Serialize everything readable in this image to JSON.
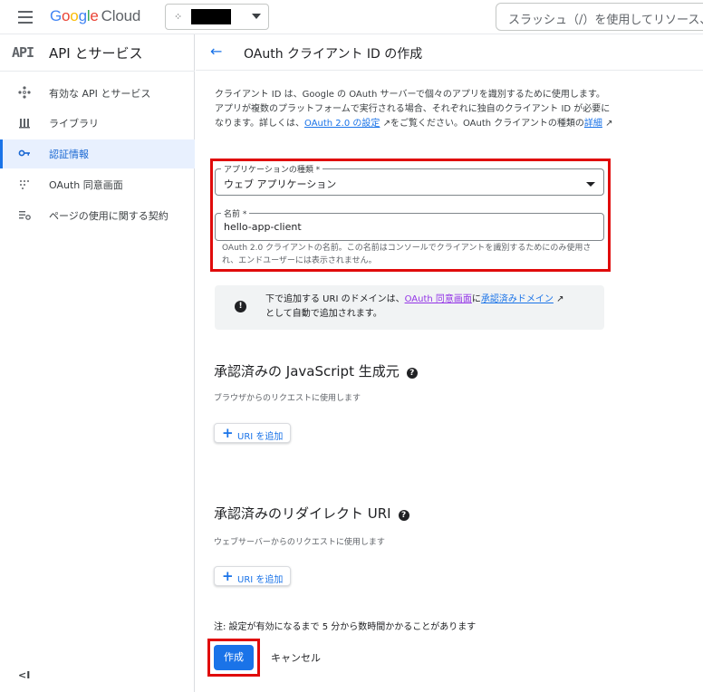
{
  "header": {
    "logo_google": "Google",
    "logo_cloud": "Cloud",
    "project_dots": "⁘",
    "search_placeholder": "スラッシュ（/）を使用してリソース、"
  },
  "sidebar": {
    "api_mark": "API",
    "title": "API とサービス",
    "items": [
      {
        "label": "有効な API とサービス",
        "icon": "api-hub-icon"
      },
      {
        "label": "ライブラリ",
        "icon": "library-icon"
      },
      {
        "label": "認証情報",
        "icon": "key-icon",
        "active": true
      },
      {
        "label": "OAuth 同意画面",
        "icon": "oauth-consent-icon"
      },
      {
        "label": "ページの使用に関する契約",
        "icon": "settings-list-icon"
      }
    ],
    "collapse": "<I"
  },
  "main": {
    "page_title": "OAuth クライアント ID の作成",
    "intro": {
      "text1": "クライアント ID は、Google の OAuth サーバーで個々のアプリを識別するために使用します。アプリが複数のプラットフォームで実行される場合、それぞれに独自のクライアント ID が必要になります。詳しくは、",
      "link1": "OAuth 2.0 の設定",
      "text2": "をご覧ください。OAuth クライアントの種類の",
      "link2": "詳細"
    },
    "app_type": {
      "label": "アプリケーションの種類 *",
      "value": "ウェブ アプリケーション"
    },
    "name_field": {
      "label": "名前 *",
      "value": "hello-app-client",
      "hint": "OAuth 2.0 クライアントの名前。この名前はコンソールでクライアントを識別するためにのみ使用され、エンドユーザーには表示されません。"
    },
    "info": {
      "text1": "下で追加する URI のドメインは、",
      "link1": "OAuth 同意画面",
      "text2": "に",
      "link2": "承認済みドメイン",
      "text3": "として自動で追加されます。"
    },
    "js_origins": {
      "title": "承認済みの JavaScript 生成元",
      "subtitle": "ブラウザからのリクエストに使用します",
      "button": "URI を追加"
    },
    "redirect_uris": {
      "title": "承認済みのリダイレクト URI",
      "subtitle": "ウェブサーバーからのリクエストに使用します",
      "button": "URI を追加"
    },
    "note": "注: 設定が有効になるまで 5 分から数時間かかることがあります",
    "create_label": "作成",
    "cancel_label": "キャンセル"
  },
  "colors": {
    "accent": "#1a73e8",
    "highlight": "#e00b0b"
  }
}
